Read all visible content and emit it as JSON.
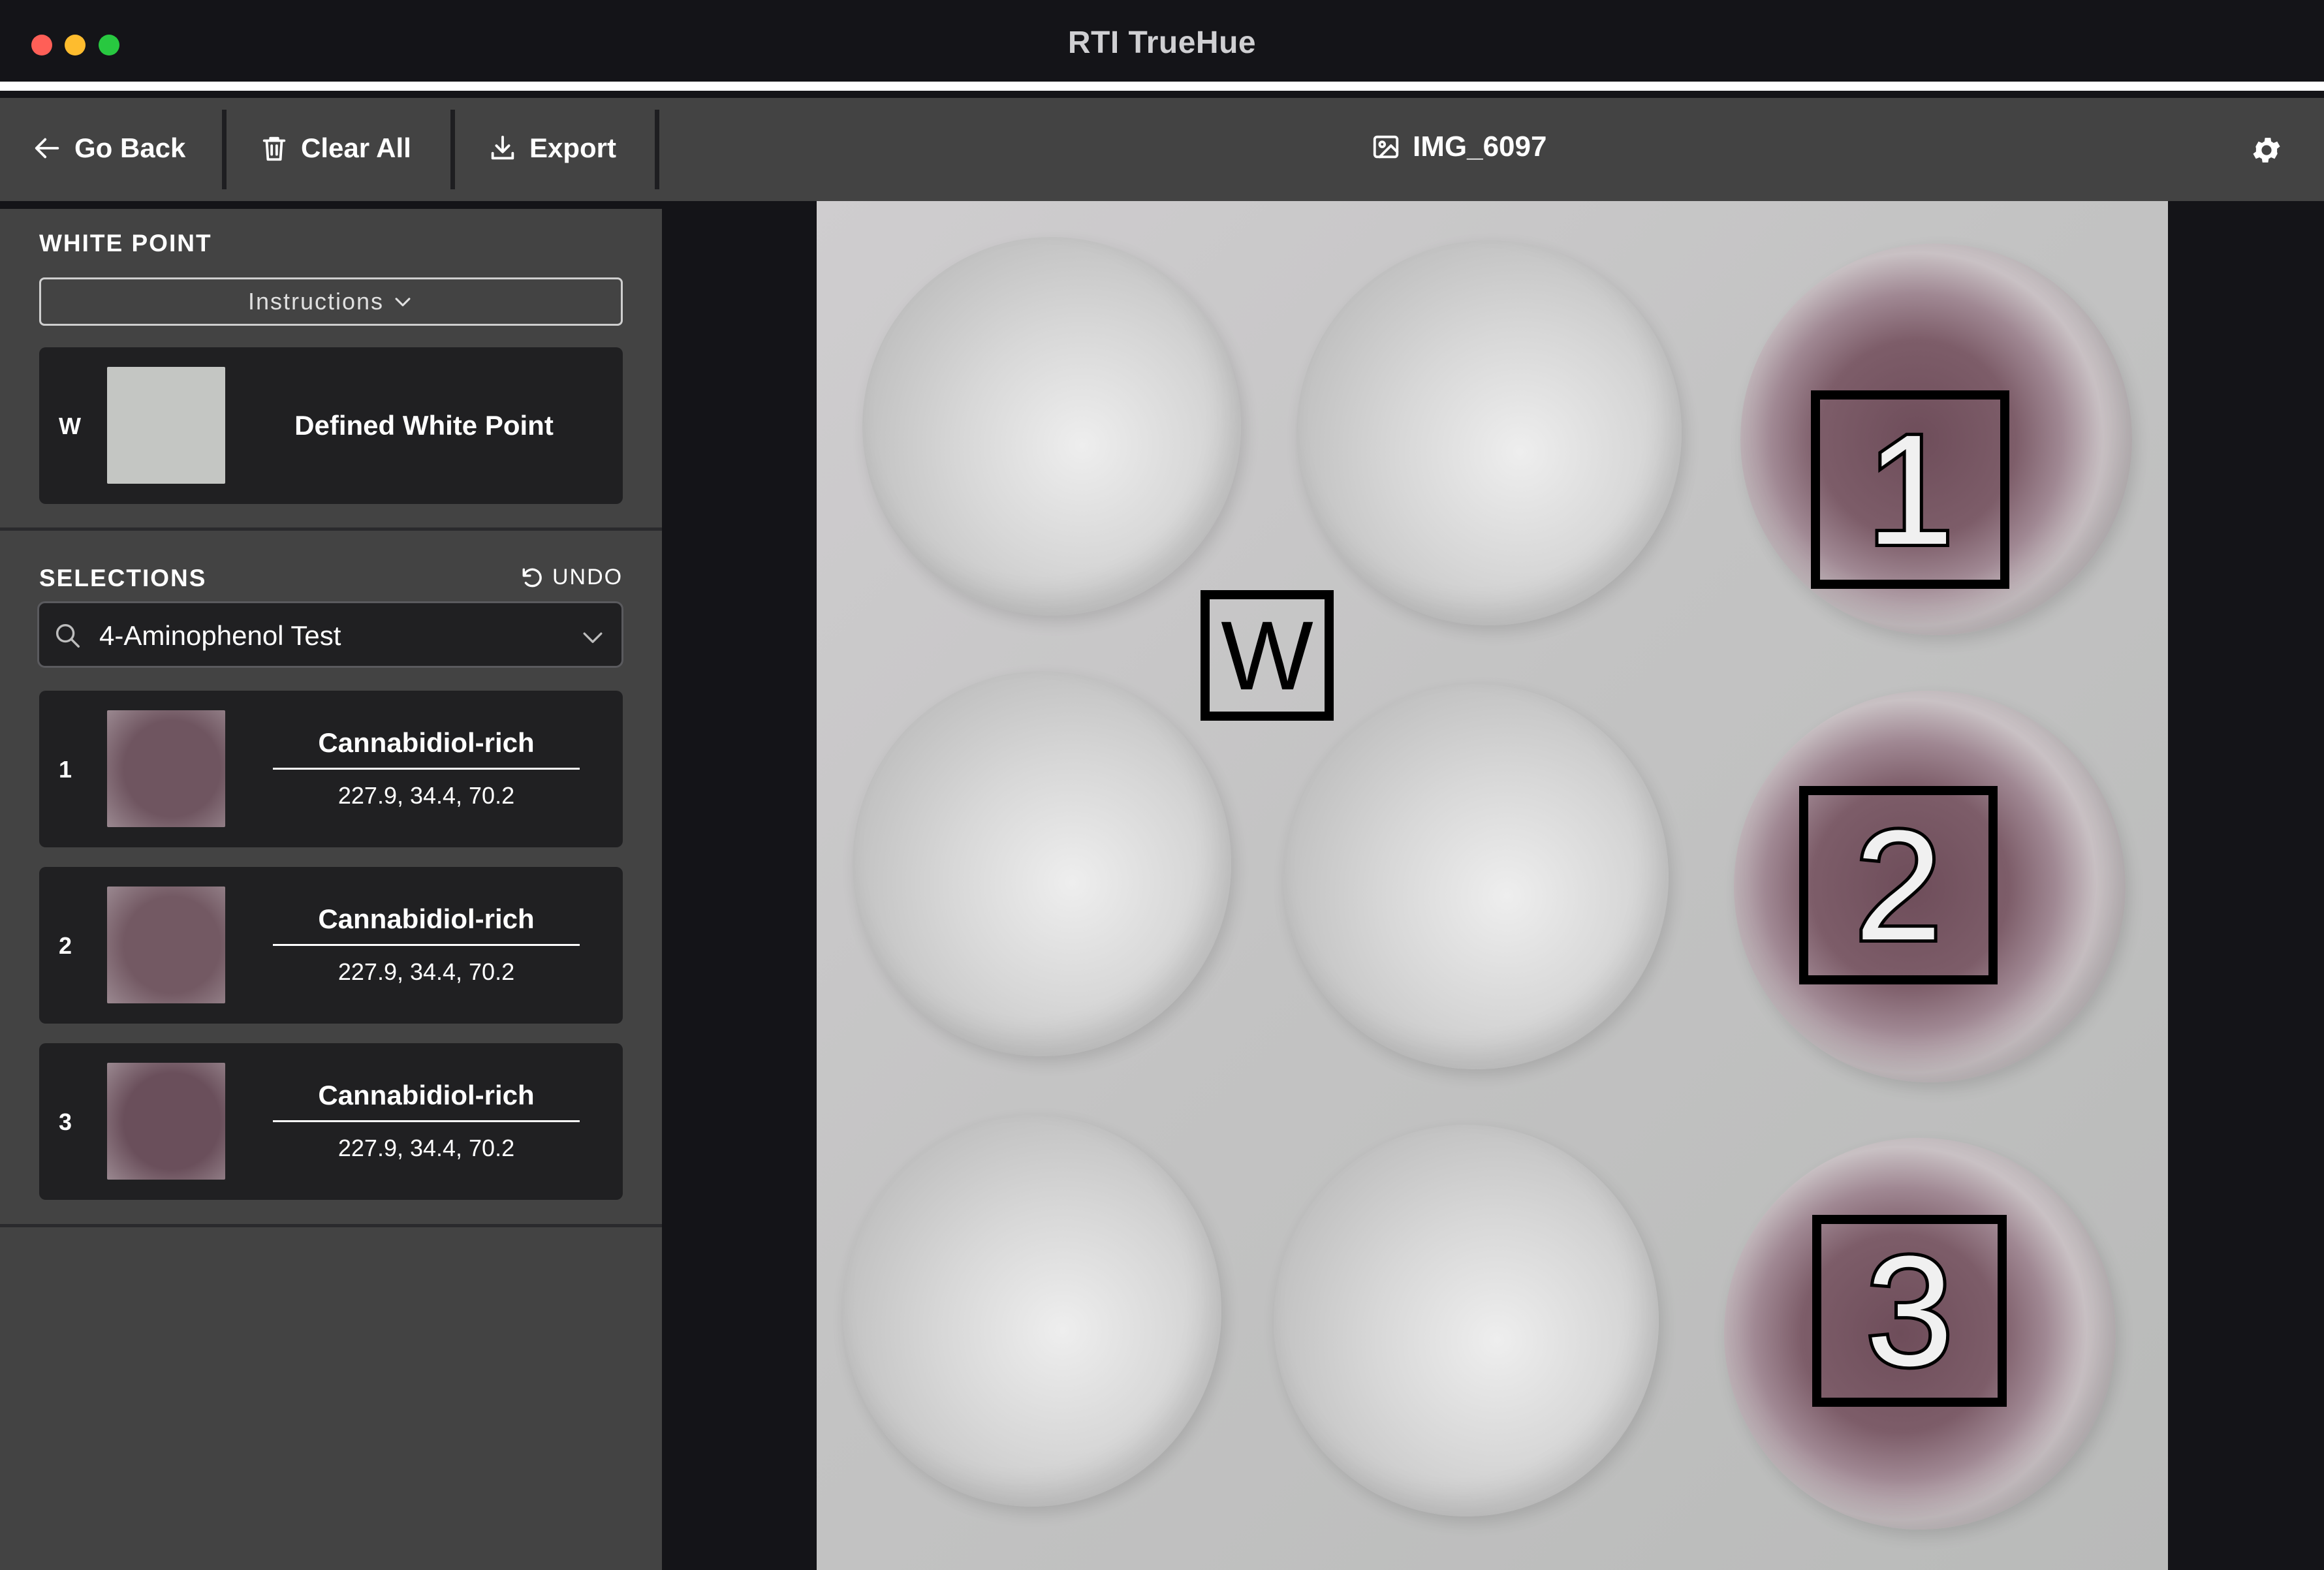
{
  "window": {
    "title": "RTI TrueHue"
  },
  "toolbar": {
    "go_back": "Go Back",
    "clear_all": "Clear All",
    "export": "Export",
    "file_name": "IMG_6097"
  },
  "white_point": {
    "heading": "WHITE POINT",
    "instructions": "Instructions",
    "index": "W",
    "label": "Defined White Point",
    "swatch_color": "#c4c6c3"
  },
  "selections": {
    "heading": "SELECTIONS",
    "undo": "UNDO",
    "test_value": "4-Aminophenol Test",
    "items": [
      {
        "index": "1",
        "name": "Cannabidiol-rich",
        "values": "227.9, 34.4, 70.2",
        "swatch_color": "#6f5560"
      },
      {
        "index": "2",
        "name": "Cannabidiol-rich",
        "values": "227.9, 34.4, 70.2",
        "swatch_color": "#735963"
      },
      {
        "index": "3",
        "name": "Cannabidiol-rich",
        "values": "227.9, 34.4, 70.2",
        "swatch_color": "#6a4f5b"
      }
    ]
  },
  "image": {
    "markers": [
      "W",
      "1",
      "2",
      "3"
    ]
  },
  "colors": {
    "toolbar_bg": "#434343",
    "card_bg": "#202022",
    "sample_purple": "#6f5560"
  }
}
